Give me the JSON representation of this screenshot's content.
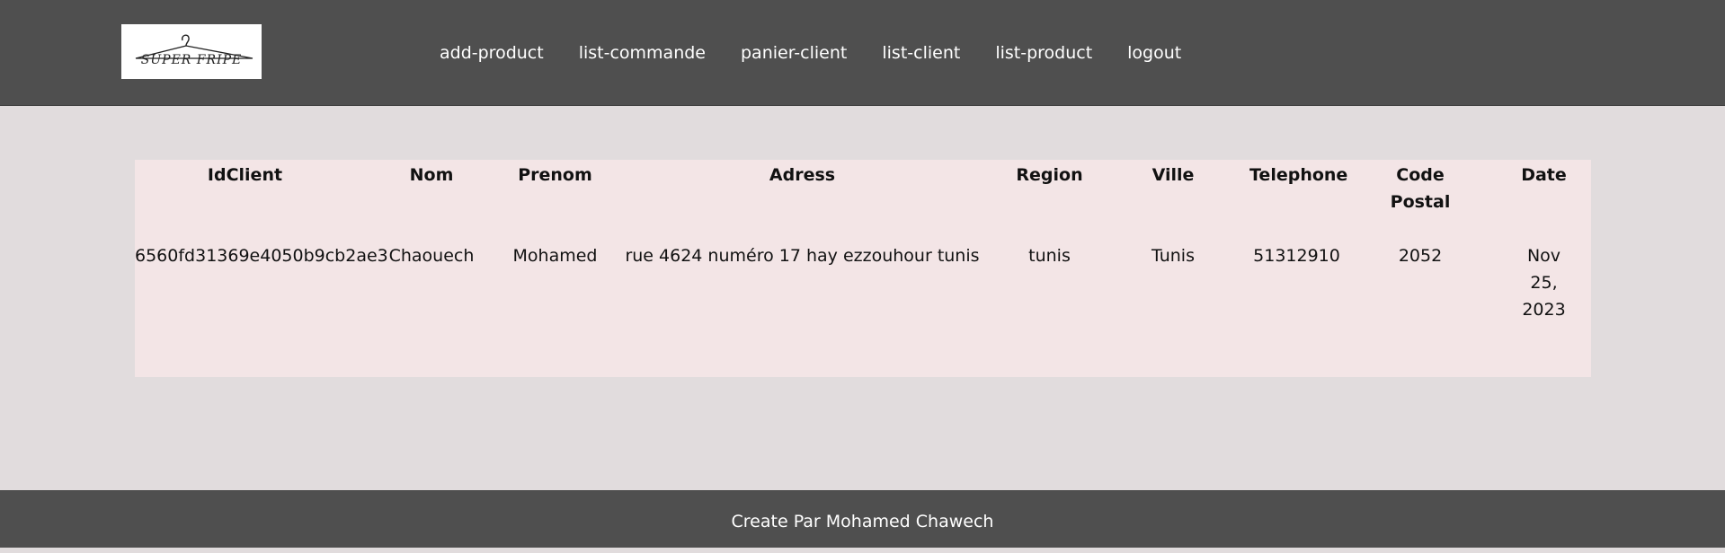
{
  "header": {
    "logo_text": "SUPER FRIPE",
    "nav": [
      {
        "label": "add-product"
      },
      {
        "label": "list-commande"
      },
      {
        "label": "panier-client"
      },
      {
        "label": "list-client"
      },
      {
        "label": "list-product"
      },
      {
        "label": "logout"
      }
    ]
  },
  "table": {
    "columns": [
      "IdClient",
      "Nom",
      "Prenom",
      "Adress",
      "Region",
      "Ville",
      "Telephone",
      "Code Postal",
      "Date"
    ],
    "rows": [
      {
        "id": "6560fd31369e4050b9cb2ae3",
        "nom": "Chaouech",
        "prenom": "Mohamed",
        "adress": "rue 4624 numéro 17 hay ezzouhour tunis",
        "region": "tunis",
        "ville": "Tunis",
        "telephone": "51312910",
        "code_postal": "2052",
        "date": "Nov 25, 2023"
      }
    ]
  },
  "footer": {
    "text": "Create Par Mohamed Chawech"
  },
  "colors": {
    "header_bg": "#4f4f4f",
    "page_bg": "#e1dcdd",
    "table_bg": "#f3e5e6",
    "footer_bg": "#4f4f4f"
  }
}
